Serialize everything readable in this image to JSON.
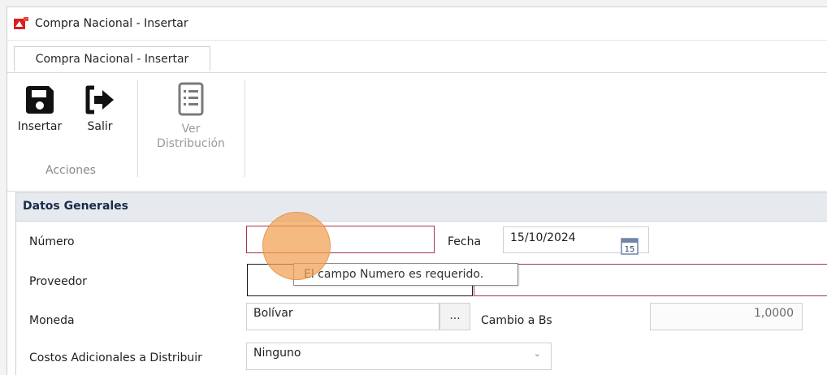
{
  "window": {
    "title": "Compra Nacional - Insertar",
    "tab_label": "Compra Nacional - Insertar"
  },
  "ribbon": {
    "insertar_label": "Insertar",
    "salir_label": "Salir",
    "ver_line1": "Ver",
    "ver_line2": "Distribución",
    "group_label": "Acciones"
  },
  "panel": {
    "title": "Datos Generales"
  },
  "form": {
    "numero_label": "Número",
    "numero_value": "",
    "fecha_label": "Fecha",
    "fecha_value": "15/10/2024",
    "calendar_day": "15",
    "proveedor_label": "Proveedor",
    "proveedor_code": "",
    "proveedor_name": "",
    "moneda_label": "Moneda",
    "moneda_value": "Bolívar",
    "ellipsis": "...",
    "cambio_label": "Cambio a Bs",
    "cambio_value": "1,0000",
    "costos_label": "Costos Adicionales a Distribuir",
    "costos_value": "Ninguno"
  },
  "validation": {
    "tooltip": "El campo Numero es requerido."
  },
  "colors": {
    "invalid_border": "#a3364a",
    "header_bg": "#e6e9ee",
    "header_text": "#1a2c4a",
    "cursor_highlight": "#f1a050"
  },
  "icons": [
    "app-icon",
    "save-icon",
    "exit-icon",
    "document-list-icon",
    "calendar-icon",
    "chevron-down-icon"
  ]
}
